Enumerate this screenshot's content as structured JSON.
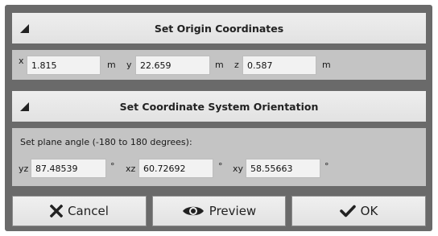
{
  "origin": {
    "title": "Set Origin Coordinates",
    "x_label": "x",
    "x_value": "1.815",
    "y_label": "y",
    "y_value": "22.659",
    "z_label": "z",
    "z_value": "0.587",
    "unit": "m"
  },
  "orientation": {
    "title": "Set Coordinate System Orientation",
    "plane_angle_label": "Set plane angle (-180 to 180 degrees):",
    "yz_label": "yz",
    "yz_value": "87.48539",
    "xz_label": "xz",
    "xz_value": "60.72692",
    "xy_label": "xy",
    "xy_value": "58.55663",
    "unit": "°"
  },
  "buttons": {
    "cancel": "Cancel",
    "preview": "Preview",
    "ok": "OK"
  },
  "icons": {
    "collapse": "collapse-triangle-icon",
    "cancel": "x-icon",
    "preview": "eye-icon",
    "ok": "checkmark-icon"
  },
  "colors": {
    "dialog_bg": "#6a6a6a",
    "panel_bg": "#c4c4c4",
    "header_bg": "#e8e8e8"
  }
}
